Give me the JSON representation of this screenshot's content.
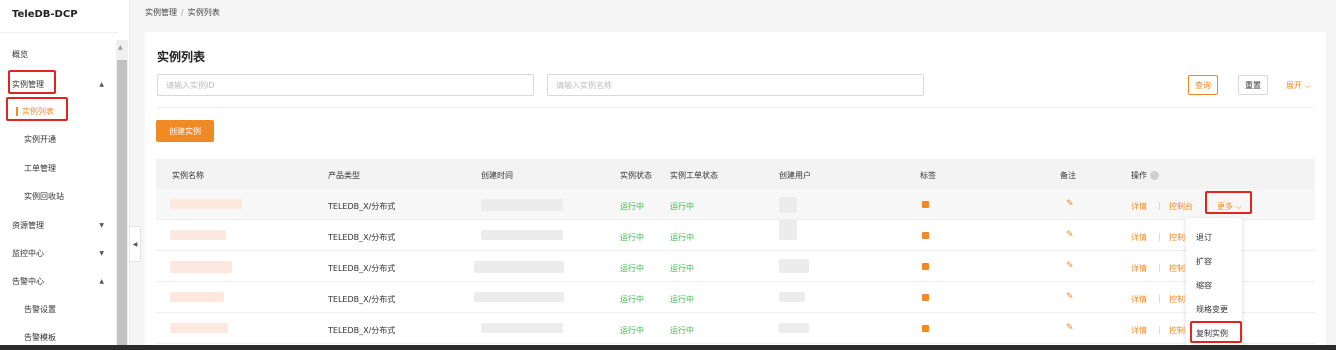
{
  "sidebar": {
    "logo": "TeleDB-DCP",
    "items": [
      {
        "label": "概览"
      },
      {
        "label": "实例管理"
      },
      {
        "label": "实例列表"
      },
      {
        "label": "实例开通"
      },
      {
        "label": "工单管理"
      },
      {
        "label": "实例回收站"
      },
      {
        "label": "资源管理"
      },
      {
        "label": "监控中心"
      },
      {
        "label": "告警中心"
      },
      {
        "label": "告警设置"
      },
      {
        "label": "告警模板"
      }
    ]
  },
  "breadcrumb": {
    "parent": "实例管理",
    "separator": "/",
    "current": "实例列表"
  },
  "page": {
    "title": "实例列表",
    "search_id_placeholder": "请输入实例ID",
    "search_name_placeholder": "请输入实例名称",
    "query_label": "查询",
    "reset_label": "重置",
    "expand_label": "展开",
    "create_label": "创建实例"
  },
  "table": {
    "columns": [
      "实例名称",
      "产品类型",
      "创建时间",
      "实例状态",
      "实例工单状态",
      "创建用户",
      "标签",
      "备注",
      "操作"
    ],
    "rows": [
      {
        "product": "TELEDB_X/分布式",
        "status": "运行中",
        "order_status": "运行中"
      },
      {
        "product": "TELEDB_X/分布式",
        "status": "运行中",
        "order_status": "运行中"
      },
      {
        "product": "TELEDB_X/分布式",
        "status": "运行中",
        "order_status": "运行中"
      },
      {
        "product": "TELEDB_X/分布式",
        "status": "运行中",
        "order_status": "运行中"
      },
      {
        "product": "TELEDB_X/分布式",
        "status": "运行中",
        "order_status": "运行中"
      }
    ],
    "ops": {
      "detail": "详情",
      "console": "控制台",
      "console_short": "控制",
      "more": "更多"
    }
  },
  "more_menu": [
    "退订",
    "扩容",
    "缩容",
    "规格变更",
    "复制实例"
  ],
  "colors": {
    "accent": "#f08a24",
    "running": "#3fb950",
    "highlight": "#e0261f"
  }
}
